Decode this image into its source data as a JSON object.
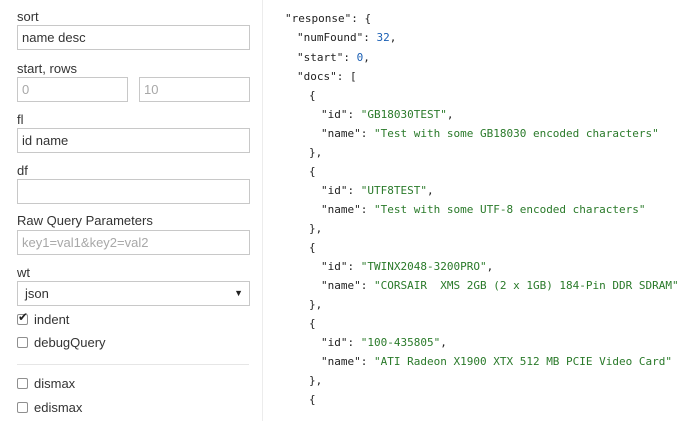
{
  "form": {
    "sort_label": "sort",
    "sort_value": "name desc",
    "start_rows_label": "start, rows",
    "start_placeholder": "0",
    "rows_placeholder": "10",
    "fl_label": "fl",
    "fl_value": "id name",
    "df_label": "df",
    "df_value": "",
    "raw_label": "Raw Query Parameters",
    "raw_placeholder": "key1=val1&key2=val2",
    "wt_label": "wt",
    "wt_value": "json",
    "indent_label": "indent",
    "indent_checked": true,
    "debug_label": "debugQuery",
    "debug_checked": false,
    "dismax_label": "dismax",
    "dismax_checked": false,
    "edismax_label": "edismax",
    "edismax_checked": false
  },
  "response": {
    "numFound": "32",
    "start": "0",
    "docs": [
      {
        "id": "GB18030TEST",
        "name": "Test with some GB18030 encoded characters"
      },
      {
        "id": "UTF8TEST",
        "name": "Test with some UTF-8 encoded characters"
      },
      {
        "id": "TWINX2048-3200PRO",
        "name": "CORSAIR  XMS 2GB (2 x 1GB) 184-Pin DDR SDRAM"
      },
      {
        "id": "100-435805",
        "name": "ATI Radeon X1900 XTX 512 MB PCIE Video Card"
      }
    ]
  }
}
